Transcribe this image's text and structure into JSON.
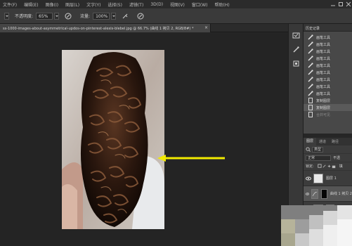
{
  "menu": {
    "items": [
      "文件(F)",
      "编辑(E)",
      "图像(I)",
      "图层(L)",
      "文字(Y)",
      "选择(S)",
      "滤镜(T)",
      "3D(D)",
      "视图(V)",
      "窗口(W)",
      "帮助(H)"
    ]
  },
  "options": {
    "opacity_label": "不透明度:",
    "opacity_value": "65%",
    "flow_label": "流量:",
    "flow_value": "100%"
  },
  "document": {
    "tab_title": "ss-1000-images-about-asymmetrical-updos-on-pinterest-alexis-blebel.jpg @ 66.7% (曲线 1 拷贝 2, RGB/8#) *",
    "close_glyph": "×"
  },
  "history": {
    "title": "历史记录",
    "items": [
      {
        "label": "画笔工具",
        "icon": "brush-icon",
        "state": "normal"
      },
      {
        "label": "画笔工具",
        "icon": "brush-icon",
        "state": "normal"
      },
      {
        "label": "画笔工具",
        "icon": "brush-icon",
        "state": "normal"
      },
      {
        "label": "画笔工具",
        "icon": "brush-icon",
        "state": "normal"
      },
      {
        "label": "画笔工具",
        "icon": "brush-icon",
        "state": "normal"
      },
      {
        "label": "画笔工具",
        "icon": "brush-icon",
        "state": "normal"
      },
      {
        "label": "画笔工具",
        "icon": "brush-icon",
        "state": "normal"
      },
      {
        "label": "画笔工具",
        "icon": "brush-icon",
        "state": "normal"
      },
      {
        "label": "画笔工具",
        "icon": "brush-icon",
        "state": "normal"
      },
      {
        "label": "复制图层",
        "icon": "layer-doc-icon",
        "state": "normal"
      },
      {
        "label": "复制图层",
        "icon": "layer-doc-icon",
        "state": "selected"
      },
      {
        "label": "合并可见",
        "icon": "layer-doc-icon",
        "state": "dimmed"
      }
    ]
  },
  "layers": {
    "tabs": [
      "图层",
      "通道",
      "路径"
    ],
    "kind_label": "类型",
    "blend_mode": "正常",
    "opacity_short": "不透",
    "lock_label": "锁定:",
    "fill_short": "填",
    "items": [
      {
        "name": "图层 1",
        "has_mask": false
      },
      {
        "name": "曲线 1 拷贝 2",
        "has_mask": true
      },
      {
        "name": "",
        "has_mask": true
      }
    ]
  },
  "colors": {
    "annotation_arrow": "#f2ea00",
    "ui_dark": "#262626",
    "panel": "#484848"
  }
}
